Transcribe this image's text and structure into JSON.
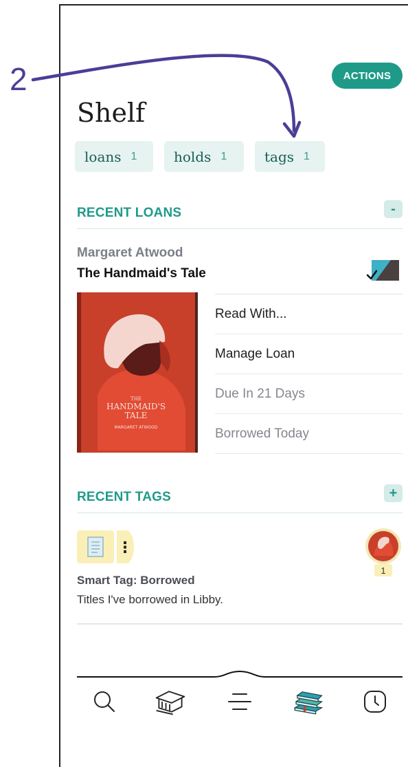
{
  "annotation": {
    "number": "2"
  },
  "header": {
    "actions_label": "ACTIONS",
    "title": "Shelf"
  },
  "chips": [
    {
      "label": "loans",
      "count": "1"
    },
    {
      "label": "holds",
      "count": "1"
    },
    {
      "label": "tags",
      "count": "1"
    }
  ],
  "recent_loans": {
    "heading": "RECENT LOANS",
    "toggle": "-",
    "author": "Margaret Atwood",
    "title": "The Handmaid's Tale",
    "cover_text": {
      "line1": "THE",
      "line2": "HANDMAID'S",
      "line3": "TALE",
      "author": "MARGARET ATWOOD"
    },
    "actions": [
      "Read With...",
      "Manage Loan",
      "Due In 21 Days",
      "Borrowed Today"
    ]
  },
  "recent_tags": {
    "heading": "RECENT TAGS",
    "toggle": "+",
    "menu_glyph": "⋮",
    "avatar_count": "1",
    "tag_name": "Smart Tag: Borrowed",
    "tag_description": "Titles I've borrowed in Libby."
  },
  "bottom_nav": {
    "icons": [
      "search-icon",
      "library-icon",
      "menu-icon",
      "shelf-icon",
      "activity-icon"
    ]
  },
  "colors": {
    "accent": "#1f9a89",
    "chip_bg": "#e6f3f1",
    "annotation": "#4b3e97",
    "cover_red": "#c8402a"
  }
}
